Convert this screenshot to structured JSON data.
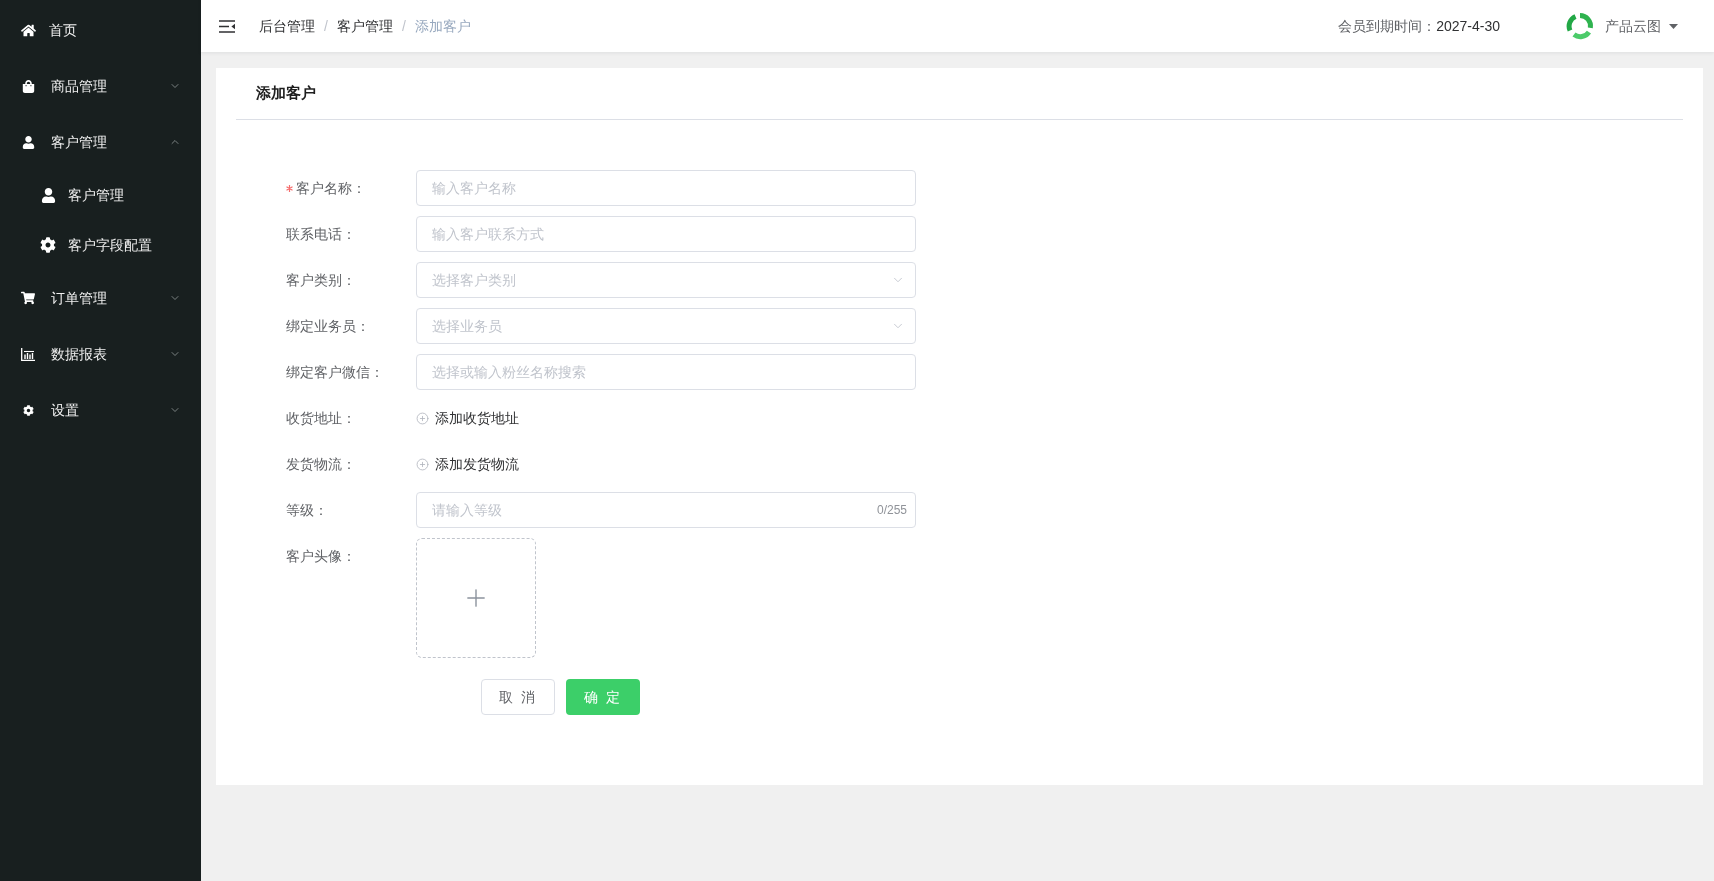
{
  "sidebar": {
    "items": [
      {
        "kind": "link",
        "label": "首页"
      },
      {
        "kind": "submenu",
        "label": "商品管理",
        "expanded": false
      },
      {
        "kind": "submenu",
        "label": "客户管理",
        "expanded": true,
        "children": [
          {
            "label": "客户管理"
          },
          {
            "label": "客户字段配置"
          }
        ]
      },
      {
        "kind": "submenu",
        "label": "订单管理",
        "expanded": false
      },
      {
        "kind": "submenu",
        "label": "数据报表",
        "expanded": false
      },
      {
        "kind": "submenu",
        "label": "设置",
        "expanded": false
      }
    ]
  },
  "header": {
    "breadcrumb": [
      {
        "label": "后台管理",
        "current": false
      },
      {
        "separator": "/",
        "label": "客户管理",
        "current": false
      },
      {
        "separator": "/",
        "label": "添加客户",
        "current": true
      }
    ],
    "expiry_label": "会员到期时间：",
    "expiry_date": "2027-4-30",
    "user": "产品云图"
  },
  "card": {
    "title": "添加客户"
  },
  "form": {
    "fields": [
      {
        "kind": "input",
        "label": "客户名称：",
        "required": true,
        "placeholder": "输入客户名称"
      },
      {
        "kind": "input",
        "label": "联系电话：",
        "required": false,
        "placeholder": "输入客户联系方式"
      },
      {
        "kind": "select",
        "label": "客户类别：",
        "required": false,
        "placeholder": "选择客户类别"
      },
      {
        "kind": "select",
        "label": "绑定业务员：",
        "required": false,
        "placeholder": "选择业务员"
      },
      {
        "kind": "input",
        "label": "绑定客户微信：",
        "required": false,
        "placeholder": "选择或输入粉丝名称搜索"
      },
      {
        "kind": "add",
        "label": "收货地址：",
        "required": false,
        "action": "添加收货地址"
      },
      {
        "kind": "add",
        "label": "发货物流：",
        "required": false,
        "action": "添加发货物流"
      },
      {
        "kind": "counted",
        "label": "等级：",
        "required": false,
        "placeholder": "请输入等级",
        "counter": "0/255"
      },
      {
        "kind": "upload",
        "label": "客户头像：",
        "required": false
      }
    ],
    "buttons": [
      {
        "kind": "default",
        "label": "取 消"
      },
      {
        "kind": "primary",
        "label": "确 定"
      }
    ]
  }
}
